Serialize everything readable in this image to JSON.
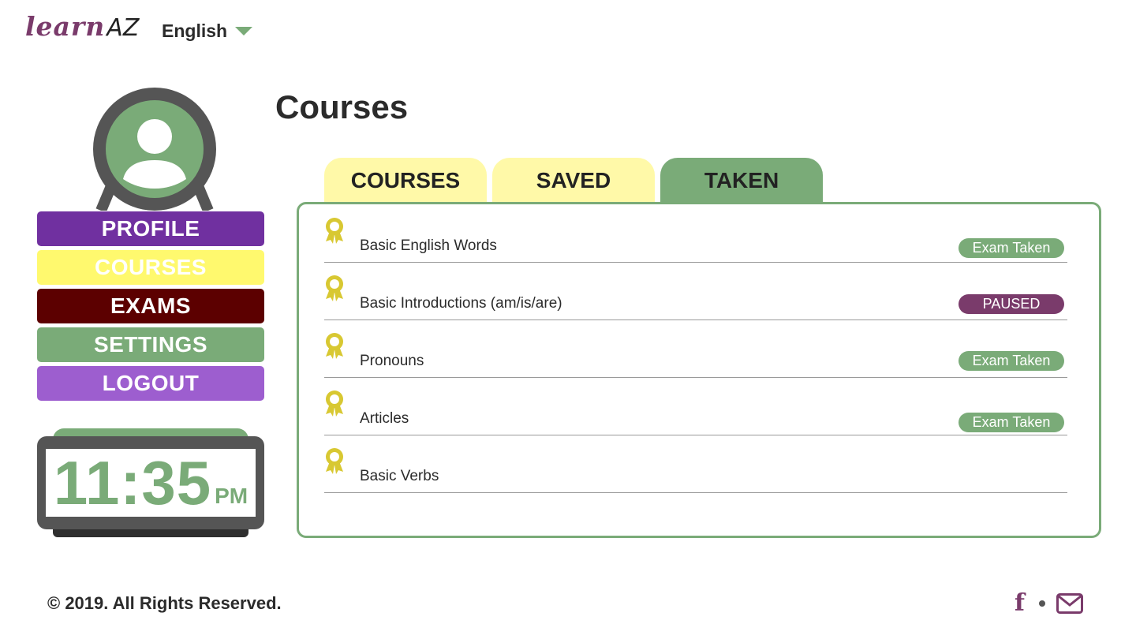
{
  "brand": {
    "learn": "learn",
    "az": "AZ"
  },
  "language": {
    "selected": "English"
  },
  "sidebar": {
    "menu": [
      {
        "label": "PROFILE"
      },
      {
        "label": "COURSES"
      },
      {
        "label": "EXAMS"
      },
      {
        "label": "SETTINGS"
      },
      {
        "label": "LOGOUT"
      }
    ],
    "clock": {
      "time": "11:35",
      "ampm": "PM"
    }
  },
  "main": {
    "title": "Courses",
    "tabs": [
      {
        "label": "COURSES"
      },
      {
        "label": "SAVED"
      },
      {
        "label": "TAKEN",
        "active": true
      }
    ],
    "courses": [
      {
        "name": "Basic English Words",
        "status": "Exam Taken"
      },
      {
        "name": "Basic Introductions (am/is/are)",
        "status": "PAUSED"
      },
      {
        "name": "Pronouns",
        "status": "Exam Taken"
      },
      {
        "name": "Articles",
        "status": "Exam Taken"
      },
      {
        "name": "Basic Verbs",
        "status": ""
      }
    ]
  },
  "footer": {
    "copyright": "© 2019. All Rights Reserved."
  },
  "icons": {
    "ribbon": "award-ribbon-icon",
    "facebook": "facebook-icon",
    "mail": "mail-icon",
    "caret": "caret-down-icon",
    "avatar": "user-avatar-icon"
  },
  "colors": {
    "green": "#7aab78",
    "plum": "#7a3b6b",
    "purple": "#7030a0",
    "yellow": "#fff96e",
    "maroon": "#5c0000",
    "lavender": "#9d5ecf",
    "ribbon": "#d8c832"
  }
}
